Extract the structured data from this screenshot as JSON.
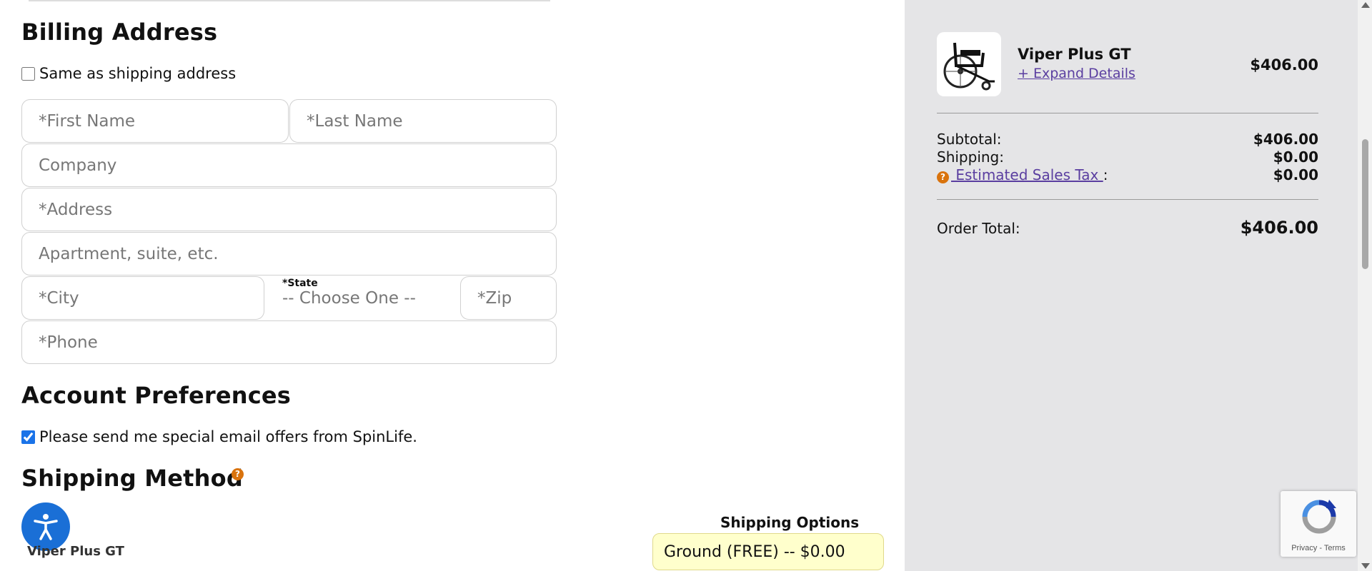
{
  "billing": {
    "title": "Billing Address",
    "same_as_shipping_label": "Same as shipping address",
    "same_as_shipping_checked": false,
    "fields": {
      "first_name_placeholder": "*First Name",
      "last_name_placeholder": "*Last Name",
      "company_placeholder": "Company",
      "address_placeholder": "*Address",
      "apartment_placeholder": "Apartment, suite, etc.",
      "city_placeholder": "*City",
      "state_label": "*State",
      "state_value": "-- Choose One --",
      "zip_placeholder": "*Zip",
      "phone_placeholder": "*Phone"
    }
  },
  "account": {
    "title": "Account Preferences",
    "offers_label": "Please send me special email offers from SpinLife.",
    "offers_checked": true
  },
  "shipping": {
    "title": "Shipping Method",
    "product_name": "Viper Plus GT",
    "options_label": "Shipping Options",
    "selected_option": "Ground (FREE) -- $0.00"
  },
  "order_summary": {
    "product": {
      "name": "Viper Plus GT",
      "expand_link": "+ Expand Details",
      "price": "$406.00"
    },
    "subtotal_label": "Subtotal:",
    "subtotal_value": "$406.00",
    "shipping_label": "Shipping:",
    "shipping_value": "$0.00",
    "tax_label": " Estimated Sales Tax ",
    "tax_colon": ":",
    "tax_value": "$0.00",
    "total_label": "Order Total:",
    "total_value": "$406.00"
  },
  "recaptcha": {
    "terms_text": "Privacy - Terms"
  },
  "icons": {
    "help": "help-icon",
    "accessibility": "accessibility-icon",
    "recaptcha": "recaptcha-logo"
  },
  "colors": {
    "sidebar_bg": "#e5e5e7",
    "link": "#5a3ea0",
    "help_icon": "#d9730d",
    "accessibility_bg": "#1a6fd6",
    "shipping_select_bg": "#ffffcc"
  }
}
